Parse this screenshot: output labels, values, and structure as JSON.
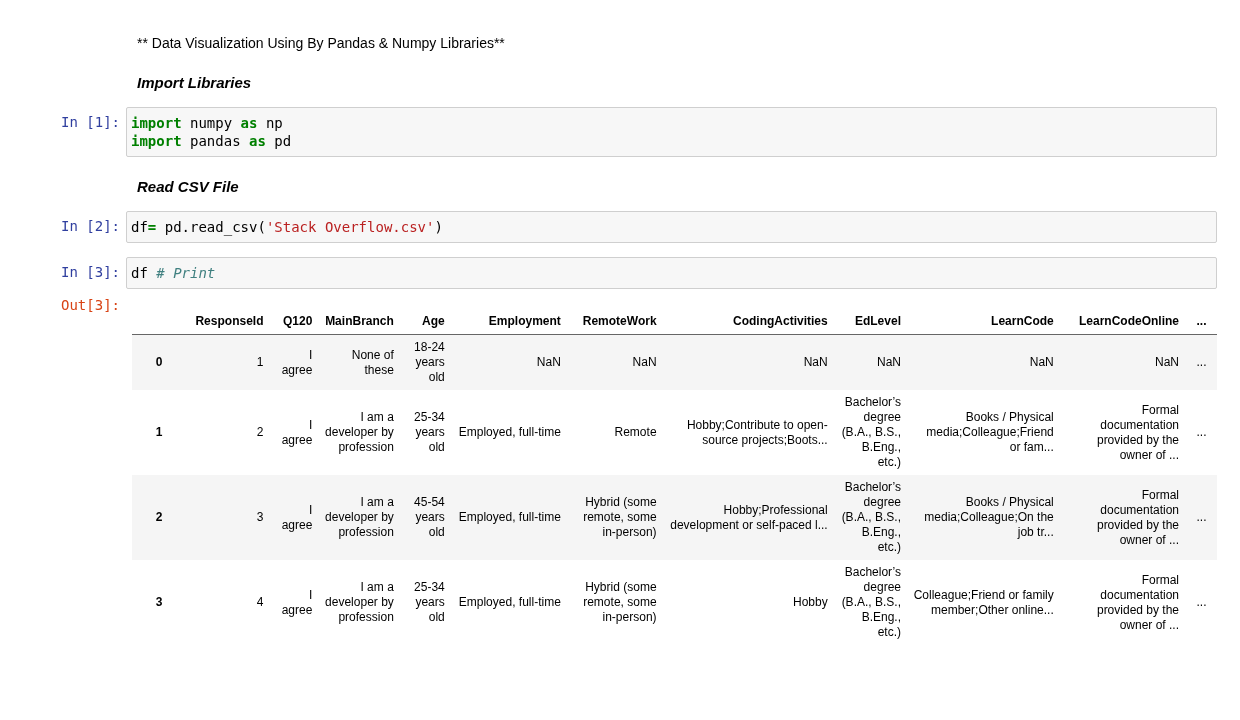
{
  "cells": [
    {
      "kind": "paragraph",
      "text": "** Data Visualization Using By Pandas & Numpy Libraries**"
    },
    {
      "kind": "heading",
      "text": "Import Libraries"
    },
    {
      "kind": "code",
      "prompt": "In [1]:",
      "lines": [
        [
          {
            "text": "import",
            "kind": "keyword"
          },
          {
            "text": " numpy ",
            "kind": "plain"
          },
          {
            "text": "as",
            "kind": "keyword"
          },
          {
            "text": " np",
            "kind": "plain"
          }
        ],
        [
          {
            "text": "import",
            "kind": "keyword"
          },
          {
            "text": " pandas ",
            "kind": "plain"
          },
          {
            "text": "as",
            "kind": "keyword"
          },
          {
            "text": " pd",
            "kind": "plain"
          }
        ]
      ]
    },
    {
      "kind": "heading",
      "text": "Read CSV File"
    },
    {
      "kind": "code",
      "prompt": "In [2]:",
      "lines": [
        [
          {
            "text": "df",
            "kind": "plain"
          },
          {
            "text": "=",
            "kind": "operator"
          },
          {
            "text": " pd.read_csv(",
            "kind": "plain"
          },
          {
            "text": "'Stack Overflow.csv'",
            "kind": "string"
          },
          {
            "text": ")",
            "kind": "plain"
          }
        ]
      ]
    },
    {
      "kind": "code",
      "prompt": "In [3]:",
      "lines": [
        [
          {
            "text": "df ",
            "kind": "plain"
          },
          {
            "text": "# Print",
            "kind": "comment"
          }
        ]
      ]
    },
    {
      "kind": "output",
      "prompt": "Out[3]:",
      "table": {
        "columns": [
          "",
          "ResponseId",
          "Q120",
          "MainBranch",
          "Age",
          "Employment",
          "RemoteWork",
          "CodingActivities",
          "EdLevel",
          "LearnCode",
          "LearnCodeOnline",
          "..."
        ],
        "rows": [
          {
            "cells": [
              "0",
              "1",
              "I agree",
              "None of these",
              "18-24 years old",
              "NaN",
              "NaN",
              "NaN",
              "NaN",
              "NaN",
              "NaN",
              "..."
            ]
          },
          {
            "cells": [
              "1",
              "2",
              "I agree",
              "I am a developer by profession",
              "25-34 years old",
              "Employed, full-time",
              "Remote",
              "Hobby;Contribute to open-source projects;Boots...",
              "Bachelor’s degree (B.A., B.S., B.Eng., etc.)",
              "Books / Physical media;Colleague;Friend or fam...",
              "Formal documentation provided by the owner of ...",
              "..."
            ]
          },
          {
            "cells": [
              "2",
              "3",
              "I agree",
              "I am a developer by profession",
              "45-54 years old",
              "Employed, full-time",
              "Hybrid (some remote, some in-person)",
              "Hobby;Professional development or self-paced l...",
              "Bachelor’s degree (B.A., B.S., B.Eng., etc.)",
              "Books / Physical media;Colleague;On the job tr...",
              "Formal documentation provided by the owner of ...",
              "..."
            ]
          },
          {
            "cells": [
              "3",
              "4",
              "I agree",
              "I am a developer by profession",
              "25-34 years old",
              "Employed, full-time",
              "Hybrid (some remote, some in-person)",
              "Hobby",
              "Bachelor’s degree (B.A., B.S., B.Eng., etc.)",
              "Colleague;Friend or family member;Other online...",
              "Formal documentation provided by the owner of ...",
              "..."
            ]
          }
        ]
      }
    }
  ]
}
